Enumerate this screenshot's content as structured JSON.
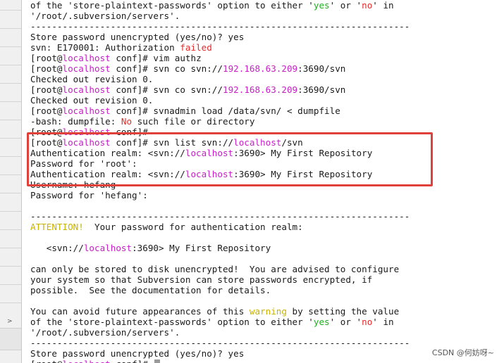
{
  "terminal": {
    "host": "localhost",
    "ip": "192.168.63.209",
    "lines": [
      {
        "segs": [
          {
            "t": "of the 'store-plaintext-passwords' option to either '"
          },
          {
            "t": "yes",
            "c": "green"
          },
          {
            "t": "' or '"
          },
          {
            "t": "no",
            "c": "red"
          },
          {
            "t": "' in"
          }
        ]
      },
      {
        "segs": [
          {
            "t": "'/root/.subversion/servers'."
          }
        ]
      },
      {
        "segs": [
          {
            "t": "-----------------------------------------------------------------------"
          }
        ]
      },
      {
        "segs": [
          {
            "t": "Store password unencrypted (yes/no)? yes"
          }
        ]
      },
      {
        "segs": [
          {
            "t": "svn: E170001: Authorization "
          },
          {
            "t": "failed",
            "c": "red"
          }
        ]
      },
      {
        "segs": [
          {
            "t": "[root@"
          },
          {
            "t": "localhost",
            "c": "host"
          },
          {
            "t": " conf]# vim authz"
          }
        ]
      },
      {
        "segs": [
          {
            "t": "[root@"
          },
          {
            "t": "localhost",
            "c": "host"
          },
          {
            "t": " conf]# svn co svn://"
          },
          {
            "t": "192.168.63.209",
            "c": "host"
          },
          {
            "t": ":3690/svn"
          }
        ]
      },
      {
        "segs": [
          {
            "t": "Checked out revision 0."
          }
        ]
      },
      {
        "segs": [
          {
            "t": "[root@"
          },
          {
            "t": "localhost",
            "c": "host"
          },
          {
            "t": " conf]# svn co svn://"
          },
          {
            "t": "192.168.63.209",
            "c": "host"
          },
          {
            "t": ":3690/svn"
          }
        ]
      },
      {
        "segs": [
          {
            "t": "Checked out revision 0."
          }
        ]
      },
      {
        "segs": [
          {
            "t": "[root@"
          },
          {
            "t": "localhost",
            "c": "host"
          },
          {
            "t": " conf]# svnadmin load /data/svn/ < dumpfile"
          }
        ]
      },
      {
        "segs": [
          {
            "t": "-bash: dumpfile: "
          },
          {
            "t": "No",
            "c": "red"
          },
          {
            "t": " such file or directory"
          }
        ]
      },
      {
        "segs": [
          {
            "t": "[root@"
          },
          {
            "t": "localhost",
            "c": "host"
          },
          {
            "t": " conf]#"
          }
        ]
      },
      {
        "segs": [
          {
            "t": "[root@"
          },
          {
            "t": "localhost",
            "c": "host"
          },
          {
            "t": " conf]# svn list svn://"
          },
          {
            "t": "localhost",
            "c": "host"
          },
          {
            "t": "/svn"
          }
        ]
      },
      {
        "segs": [
          {
            "t": "Authentication realm: <svn://"
          },
          {
            "t": "localhost",
            "c": "host"
          },
          {
            "t": ":3690> My First Repository"
          }
        ]
      },
      {
        "segs": [
          {
            "t": "Password for 'root':"
          }
        ]
      },
      {
        "segs": [
          {
            "t": "Authentication realm: <svn://"
          },
          {
            "t": "localhost",
            "c": "host"
          },
          {
            "t": ":3690> My First Repository"
          }
        ]
      },
      {
        "segs": [
          {
            "t": "Username: hefang"
          }
        ]
      },
      {
        "segs": [
          {
            "t": "Password for 'hefang':"
          }
        ]
      },
      {
        "segs": [
          {
            "t": ""
          }
        ]
      },
      {
        "segs": [
          {
            "t": "-----------------------------------------------------------------------"
          }
        ]
      },
      {
        "segs": [
          {
            "t": "ATTENTION!",
            "c": "yellow"
          },
          {
            "t": "  Your password for authentication realm:"
          }
        ]
      },
      {
        "segs": [
          {
            "t": ""
          }
        ]
      },
      {
        "segs": [
          {
            "t": "   <svn://"
          },
          {
            "t": "localhost",
            "c": "host"
          },
          {
            "t": ":3690> My First Repository"
          }
        ]
      },
      {
        "segs": [
          {
            "t": ""
          }
        ]
      },
      {
        "segs": [
          {
            "t": "can only be stored to disk unencrypted!  You are advised to configure"
          }
        ]
      },
      {
        "segs": [
          {
            "t": "your system so that Subversion can store passwords encrypted, if"
          }
        ]
      },
      {
        "segs": [
          {
            "t": "possible.  See the documentation for details."
          }
        ]
      },
      {
        "segs": [
          {
            "t": ""
          }
        ]
      },
      {
        "segs": [
          {
            "t": "You can avoid future appearances of this "
          },
          {
            "t": "warning",
            "c": "yellow"
          },
          {
            "t": " by setting the value"
          }
        ]
      },
      {
        "segs": [
          {
            "t": "of the 'store-plaintext-passwords' option to either '"
          },
          {
            "t": "yes",
            "c": "green"
          },
          {
            "t": "' or '"
          },
          {
            "t": "no",
            "c": "red"
          },
          {
            "t": "' in"
          }
        ]
      },
      {
        "segs": [
          {
            "t": "'/root/.subversion/servers'."
          }
        ]
      },
      {
        "segs": [
          {
            "t": "-----------------------------------------------------------------------"
          }
        ]
      },
      {
        "segs": [
          {
            "t": "Store password unencrypted (yes/no)? yes"
          }
        ]
      },
      {
        "segs": [
          {
            "t": "[root@"
          },
          {
            "t": "localhost",
            "c": "host"
          },
          {
            "t": " conf]# "
          }
        ],
        "cursor": true
      }
    ]
  },
  "colors": {
    "host": "#c61fc6",
    "red": "#e22a2a",
    "yellow": "#c9b300",
    "green": "#1fae1f",
    "highlight_border": "#e0403a"
  },
  "left_panel": {
    "scroll_icon": "chevron-right-icon",
    "scroll_glyph": ">"
  },
  "watermark": "CSDN @何妨呀~"
}
